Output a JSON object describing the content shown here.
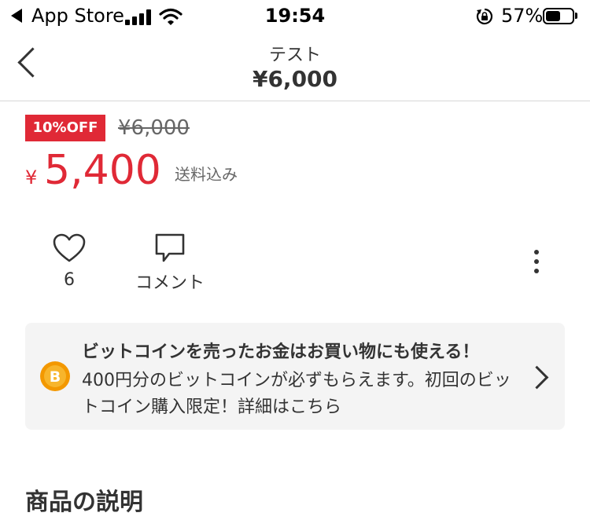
{
  "status_bar": {
    "back_app": "App Store",
    "time": "19:54",
    "battery": "57%",
    "battery_level": 0.57
  },
  "nav": {
    "subtitle": "テスト",
    "title": "¥6,000"
  },
  "price": {
    "discount_badge": "10%OFF",
    "original_price": "¥6,000",
    "yen_mark": "¥",
    "sale_price": "5,400",
    "shipping_note": "送料込み"
  },
  "actions": {
    "like_count": "6",
    "comment_label": "コメント"
  },
  "promo": {
    "coin_letter": "B",
    "title": "ビットコインを売ったお金はお買い物にも使える！",
    "body": "400円分のビットコインが必ずもらえます。初回のビットコイン購入限定！詳細はこちら"
  },
  "section": {
    "heading": "商品の説明"
  },
  "colors": {
    "accent_red": "#e02936",
    "coin_orange": "#f39800",
    "text": "#333333"
  }
}
